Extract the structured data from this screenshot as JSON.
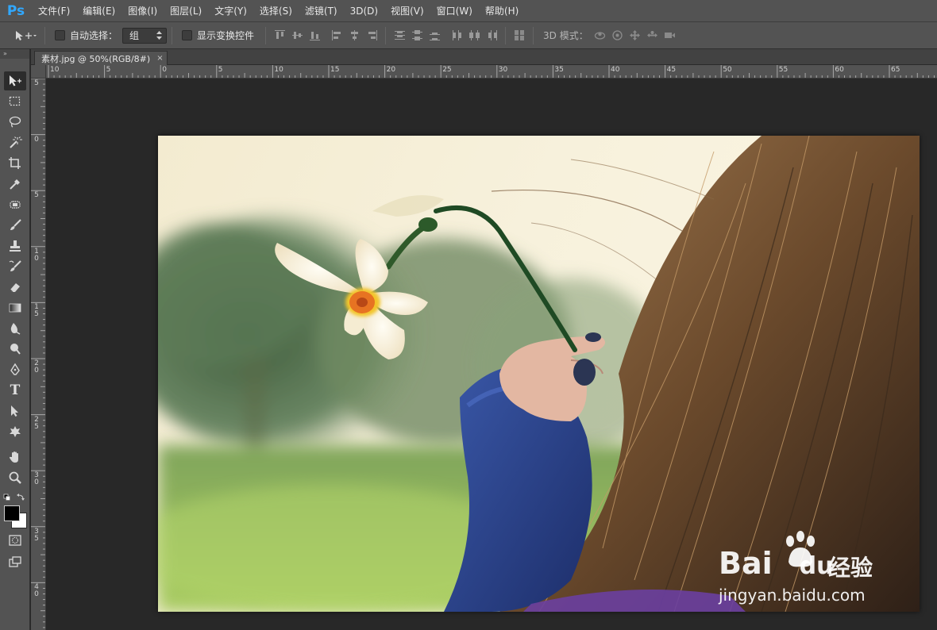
{
  "app": {
    "logo": "Ps",
    "menu": [
      "文件(F)",
      "编辑(E)",
      "图像(I)",
      "图层(L)",
      "文字(Y)",
      "选择(S)",
      "滤镜(T)",
      "3D(D)",
      "视图(V)",
      "窗口(W)",
      "帮助(H)"
    ]
  },
  "options": {
    "auto_select_label": "自动选择：",
    "auto_select_value": "组",
    "show_transform_label": "显示变换控件",
    "mode_3d_label": "3D 模式："
  },
  "document": {
    "tab_title": "素材.jpg @ 50%(RGB/8#)",
    "close_glyph": "×"
  },
  "rulers": {
    "horizontal": [
      "10",
      "5",
      "0",
      "5",
      "10",
      "15",
      "20",
      "25",
      "30",
      "35",
      "40",
      "45",
      "50",
      "55",
      "60",
      "65"
    ],
    "vertical": [
      "5",
      "0",
      "5",
      "10",
      "15",
      "20",
      "25",
      "30",
      "35",
      "40"
    ]
  },
  "toolbar": {
    "header_glyph": "»",
    "tools": [
      "move-tool",
      "marquee-tool",
      "lasso-tool",
      "magic-wand-tool",
      "crop-tool",
      "eyedropper-tool",
      "healing-brush-tool",
      "brush-tool",
      "clone-stamp-tool",
      "history-brush-tool",
      "eraser-tool",
      "gradient-tool",
      "blur-tool",
      "dodge-tool",
      "pen-tool",
      "type-tool",
      "path-selection-tool",
      "custom-shape-tool",
      "hand-tool",
      "zoom-tool"
    ],
    "type_glyph": "T",
    "foreground_color": "#000000",
    "background_color": "#ffffff"
  },
  "watermark": {
    "brand": "Bai",
    "brand_suffix": "du",
    "cn": "经验",
    "url": "jingyan.baidu.com"
  },
  "colors": {
    "ui_panel": "#535353",
    "ui_dark": "#282828",
    "accent": "#31a8ff"
  }
}
